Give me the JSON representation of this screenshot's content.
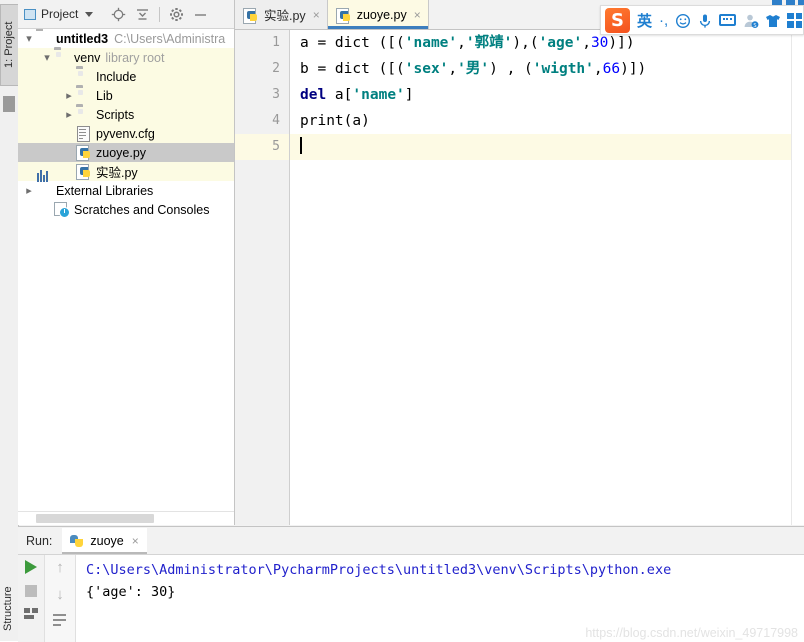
{
  "app": {
    "left_tabs": {
      "project": "1: Project",
      "structure": "Structure"
    }
  },
  "project_panel": {
    "title": "Project",
    "icons": [
      "locate-icon",
      "collapse-all-icon",
      "settings-icon",
      "hide-icon"
    ],
    "tree": [
      {
        "label": "untitled3",
        "detail": "C:\\Users\\Administra",
        "icon": "folder-icon",
        "arrow": "down",
        "indent": 0,
        "bold": true,
        "state": "normal"
      },
      {
        "label": "venv",
        "detail": "library root",
        "icon": "folder-icon",
        "arrow": "down",
        "indent": 1,
        "bold": false,
        "state": "yellow"
      },
      {
        "label": "Include",
        "detail": "",
        "icon": "folder-icon",
        "arrow": "none",
        "indent": 2,
        "bold": false,
        "state": "yellow"
      },
      {
        "label": "Lib",
        "detail": "",
        "icon": "folder-icon",
        "arrow": "right",
        "indent": 2,
        "bold": false,
        "state": "yellow"
      },
      {
        "label": "Scripts",
        "detail": "",
        "icon": "folder-icon",
        "arrow": "right",
        "indent": 2,
        "bold": false,
        "state": "yellow"
      },
      {
        "label": "pyvenv.cfg",
        "detail": "",
        "icon": "cfg-file-icon",
        "arrow": "none",
        "indent": 2,
        "bold": false,
        "state": "yellow"
      },
      {
        "label": "zuoye.py",
        "detail": "",
        "icon": "python-file-icon",
        "arrow": "none",
        "indent": 2,
        "bold": false,
        "state": "selected"
      },
      {
        "label": "实验.py",
        "detail": "",
        "icon": "python-file-icon",
        "arrow": "none",
        "indent": 2,
        "bold": false,
        "state": "yellow"
      },
      {
        "label": "External Libraries",
        "detail": "",
        "icon": "external-libraries-icon",
        "arrow": "right",
        "indent": 0,
        "bold": false,
        "state": "normal"
      },
      {
        "label": "Scratches and Consoles",
        "detail": "",
        "icon": "scratches-icon",
        "arrow": "none",
        "indent": 1,
        "bold": false,
        "state": "normal"
      }
    ]
  },
  "editor": {
    "tabs": [
      {
        "label": "实验.py",
        "active": false,
        "close": "×"
      },
      {
        "label": "zuoye.py",
        "active": true,
        "close": "×"
      }
    ],
    "line_numbers": [
      "1",
      "2",
      "3",
      "4",
      "5"
    ],
    "current_line": 5,
    "code_lines": [
      {
        "n": 1,
        "text": "a = dict ([('name','郭靖'),('age',30)])"
      },
      {
        "n": 2,
        "text": "b = dict ([('sex','男') , ('wigth',66)])"
      },
      {
        "n": 3,
        "text": "del a['name']"
      },
      {
        "n": 4,
        "text": "print(a)"
      },
      {
        "n": 5,
        "text": ""
      }
    ],
    "tokens": {
      "l1": {
        "a": "a = dict ([(",
        "s1": "'name'",
        "c1": ",",
        "s2": "'郭靖'",
        "c2": "),(",
        "s3": "'age'",
        "c3": ",",
        "num": "30",
        "c4": ")])"
      },
      "l2": {
        "a": "b = dict ([(",
        "s1": "'sex'",
        "c1": ",",
        "s2": "'男'",
        "c2": ") , (",
        "s3": "'wigth'",
        "c3": ",",
        "num": "66",
        "c4": ")])"
      },
      "l3": {
        "kw": "del",
        "a": " a[",
        "s1": "'name'",
        "c1": "]"
      },
      "l4": {
        "a": "print(a)"
      }
    },
    "colors": {
      "string": "#008080",
      "keyword": "#000080",
      "number": "#0000ff",
      "current_line_bg": "#fdfae4",
      "tab_active_underline": "#3d7ebd"
    }
  },
  "run_panel": {
    "label": "Run:",
    "tab_label": "zuoye",
    "tab_close": "×",
    "tool_icons": [
      "run-icon",
      "stop-icon",
      "print-icon",
      "scroll-up-icon",
      "scroll-down-icon",
      "soft-wrap-icon"
    ],
    "output": [
      {
        "text": "C:\\Users\\Administrator\\PycharmProjects\\untitled3\\venv\\Scripts\\python.exe",
        "color": "blue"
      },
      {
        "text": "{'age': 30}",
        "color": "black"
      }
    ],
    "watermark": "https://blog.csdn.net/weixin_49717998"
  },
  "ime_toolbar": {
    "name": "sogou-input-method",
    "logo": "S",
    "mode": "英",
    "punctuation": "·,",
    "items": [
      "logo",
      "mode-label",
      "punctuation-icon",
      "emoji-icon",
      "voice-icon",
      "keyboard-icon",
      "user-icon",
      "skin-icon",
      "toolbox-icon"
    ]
  }
}
